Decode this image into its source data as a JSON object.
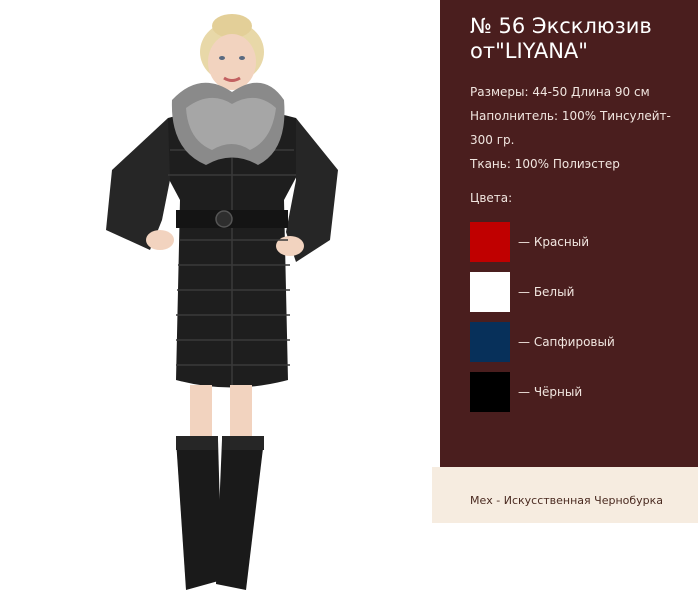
{
  "product": {
    "title": "№ 56 Эксклюзив от\"LIYANA\"",
    "specs": [
      "Размеры: 44-50 Длина 90 см",
      "Наполнитель: 100% Тинсулейт-\n300 гр.",
      "Ткань: 100% Полиэстер"
    ]
  },
  "colors": {
    "heading": "Цвета:",
    "items": [
      {
        "label": "— Красный",
        "hex": "#c00000"
      },
      {
        "label": "— Белый",
        "hex": "#ffffff"
      },
      {
        "label": "— Сапфировый",
        "hex": "#07305a"
      },
      {
        "label": "— Чёрный",
        "hex": "#000000"
      }
    ]
  },
  "footer": {
    "note": "Мех - Искусственная Чернобурка"
  },
  "theme": {
    "panel_bg": "#4a1e1e",
    "footer_bg": "#f6ece0"
  }
}
